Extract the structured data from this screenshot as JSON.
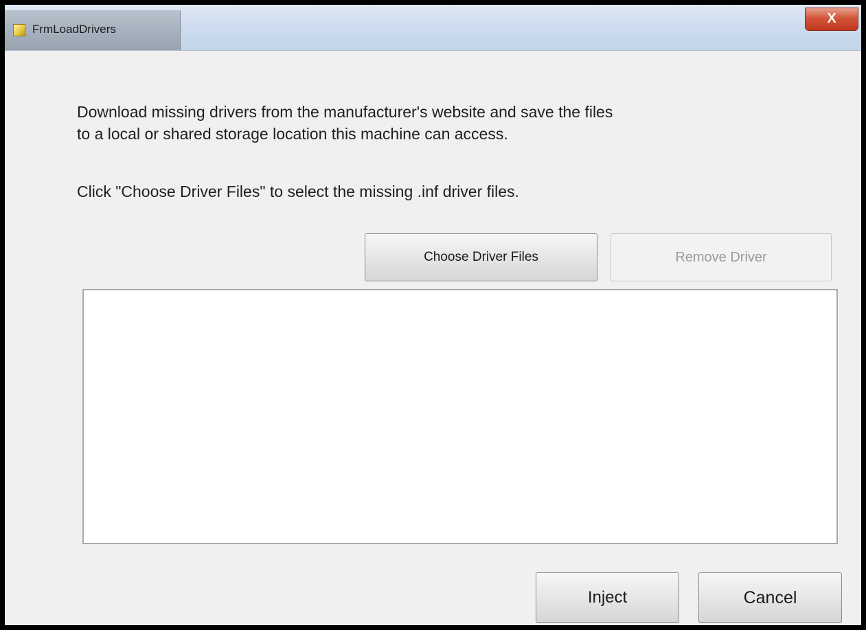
{
  "window": {
    "title": "FrmLoadDrivers",
    "close_glyph": "X",
    "icon": "app-icon"
  },
  "instructions": {
    "line1": "Download missing drivers from the manufacturer's website and save the files",
    "line2": "to a local or shared storage location this machine can access.",
    "line3": "Click \"Choose Driver Files\" to select the missing .inf driver files."
  },
  "buttons": {
    "choose_driver_files": "Choose Driver Files",
    "remove_driver": "Remove Driver",
    "inject": "Inject",
    "cancel": "Cancel"
  },
  "driver_list": {
    "items": []
  },
  "colors": {
    "close_button": "#c0381e",
    "dialog_background": "#f0f0f0"
  }
}
